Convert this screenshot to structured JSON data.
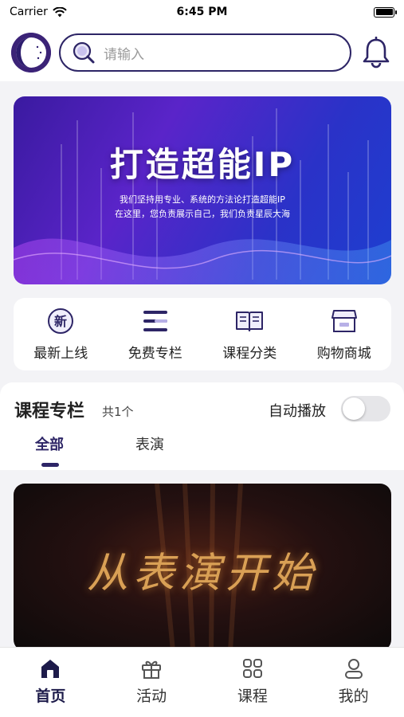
{
  "status_bar": {
    "carrier": "Carrier",
    "time": "6:45 PM"
  },
  "search": {
    "placeholder": "请输入"
  },
  "banner": {
    "title": "打造超能IP",
    "subtitle_line1": "我们坚持用专业、系统的方法论打造超能IP",
    "subtitle_line2": "在这里，您负责展示自己，我们负责星辰大海"
  },
  "quick_menu": [
    {
      "label": "最新上线",
      "icon": "new-badge-icon"
    },
    {
      "label": "免费专栏",
      "icon": "list-icon"
    },
    {
      "label": "课程分类",
      "icon": "book-icon"
    },
    {
      "label": "购物商城",
      "icon": "store-icon"
    }
  ],
  "course_section": {
    "title": "课程专栏",
    "count": "共1个",
    "autoplay_label": "自动播放",
    "autoplay_on": false,
    "tabs": [
      "全部",
      "表演"
    ],
    "active_tab": "全部"
  },
  "video_card": {
    "title": "从表演开始"
  },
  "tab_bar": [
    {
      "label": "首页",
      "icon": "home-icon",
      "active": true
    },
    {
      "label": "活动",
      "icon": "gift-icon",
      "active": false
    },
    {
      "label": "课程",
      "icon": "grid-icon",
      "active": false
    },
    {
      "label": "我的",
      "icon": "user-icon",
      "active": false
    }
  ],
  "colors": {
    "accent": "#2d2566",
    "background": "#f3f3f6"
  }
}
